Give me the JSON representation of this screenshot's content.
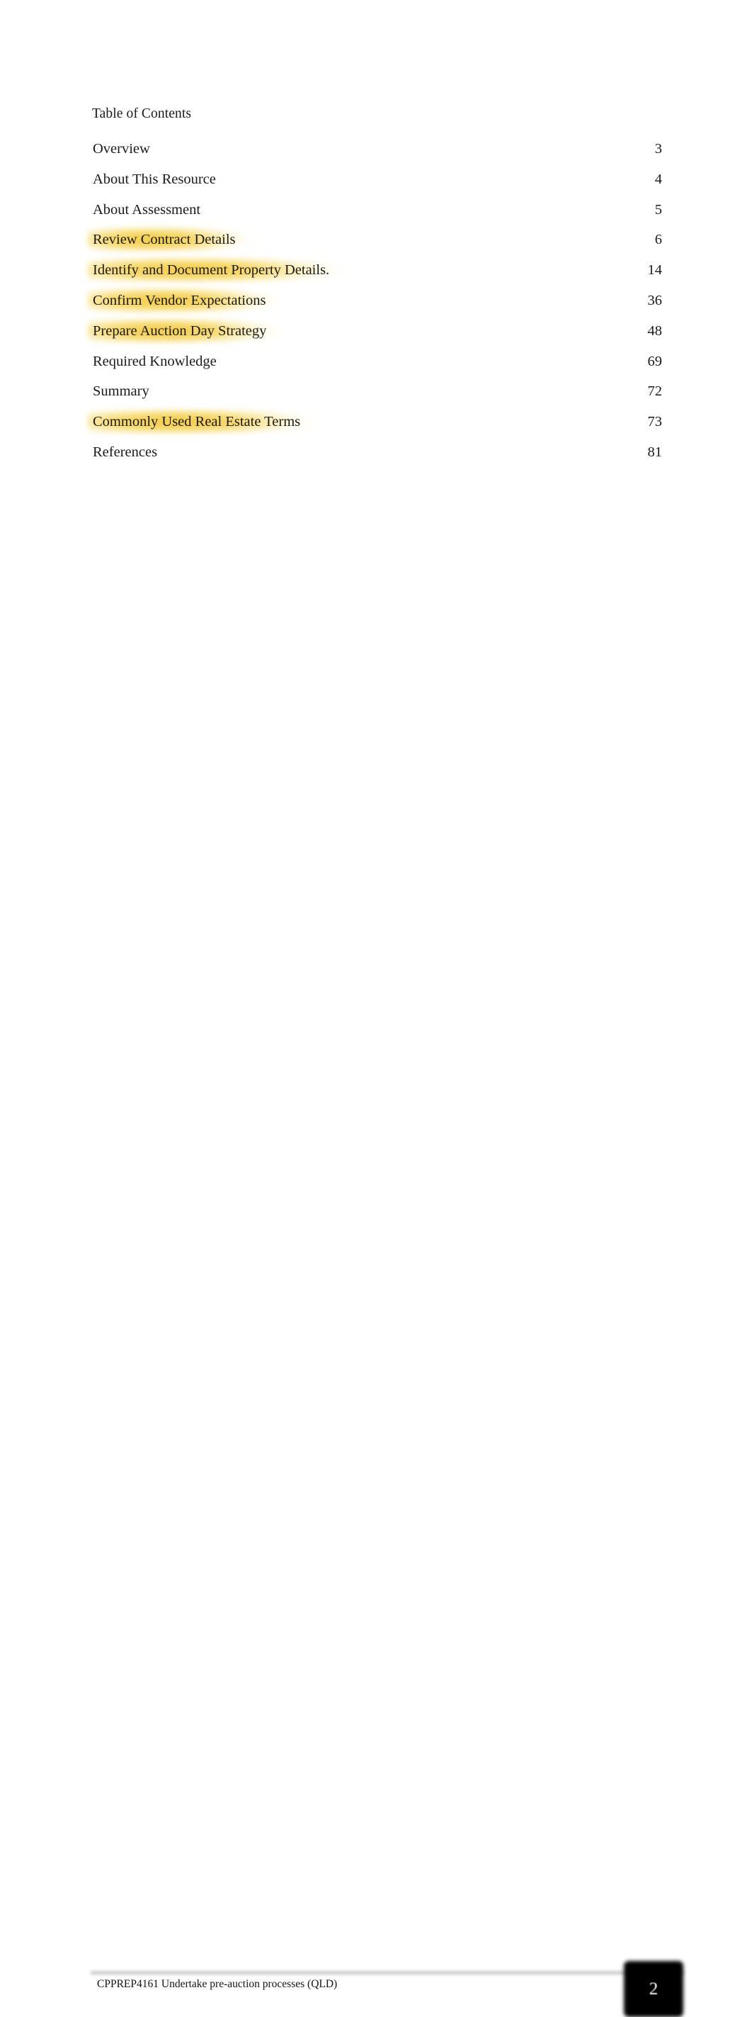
{
  "document": {
    "toc_title": "Table of Contents",
    "entries": [
      {
        "label": "Overview",
        "page": "3",
        "highlighted": false
      },
      {
        "label": "About This Resource",
        "page": "4",
        "highlighted": false
      },
      {
        "label": "About Assessment",
        "page": "5",
        "highlighted": false
      },
      {
        "label": "Review Contract Details",
        "page": "6",
        "highlighted": true
      },
      {
        "label": "Identify and Document Property Details.",
        "page": "14",
        "highlighted": true
      },
      {
        "label": "Confirm Vendor Expectations",
        "page": "36",
        "highlighted": true
      },
      {
        "label": "Prepare Auction Day Strategy",
        "page": "48",
        "highlighted": true
      },
      {
        "label": "Required Knowledge",
        "page": "69",
        "highlighted": false
      },
      {
        "label": "Summary",
        "page": "72",
        "highlighted": false
      },
      {
        "label": "Commonly Used Real Estate Terms",
        "page": "73",
        "highlighted": true
      },
      {
        "label": "References",
        "page": "81",
        "highlighted": false
      }
    ]
  },
  "footer": {
    "unit_text": "CPPREP4161 Undertake pre-auction processes (QLD)",
    "page_number": "2"
  },
  "colors": {
    "highlight": "#F3C940",
    "text": "#1A1A1A",
    "page_badge_background": "#000000",
    "page_badge_text": "#FFFFFF",
    "rule": "#A8A8A8",
    "background": "#FFFFFF"
  }
}
